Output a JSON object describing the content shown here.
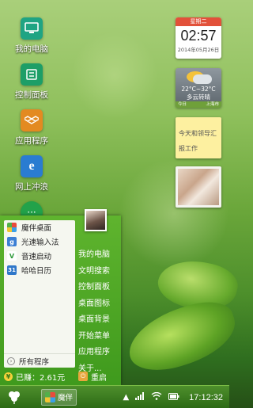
{
  "desktop": {
    "icons": [
      {
        "label": "我的电脑",
        "icon": "monitor-icon",
        "color": "#1fa483"
      },
      {
        "label": "控制面板",
        "icon": "control-panel-icon",
        "color": "#1d9e67"
      },
      {
        "label": "应用程序",
        "icon": "dropbox-icon",
        "color": "#e38a21"
      },
      {
        "label": "网上冲浪",
        "icon": "ie-icon",
        "color": "#2a7cd1"
      },
      {
        "label": "",
        "icon": "chat-icon",
        "color": "#22a24a"
      }
    ]
  },
  "widgets": {
    "clock": {
      "day": "星期二",
      "time": "02:57",
      "date": "2014年05月26日"
    },
    "weather": {
      "temp": "22°C~32°C",
      "condition": "多云转晴",
      "day_label": "今日",
      "city": "上海市"
    },
    "note": {
      "text": "今天和领导汇报工作"
    },
    "photo": {
      "icon": "photo-icon"
    }
  },
  "start_menu": {
    "apps": [
      {
        "label": "魔伴桌面",
        "icon": "mobanzhuomian-icon"
      },
      {
        "label": "光速输入法",
        "icon": "input-method-icon"
      },
      {
        "label": "音速启动",
        "icon": "launcher-icon"
      },
      {
        "label": "哈哈日历",
        "icon": "calendar-icon"
      }
    ],
    "all_programs": "所有程序",
    "right_items": [
      "我的电脑",
      "文明搜索",
      "控制面板",
      "桌面图标",
      "桌面背景",
      "开始菜单",
      "应用程序",
      "关于..."
    ],
    "earned": "已赚：2.61元",
    "restart": "重启"
  },
  "taskbar": {
    "task_label": "魔伴",
    "time": "17:12:32",
    "accent": "#2c6a15"
  }
}
